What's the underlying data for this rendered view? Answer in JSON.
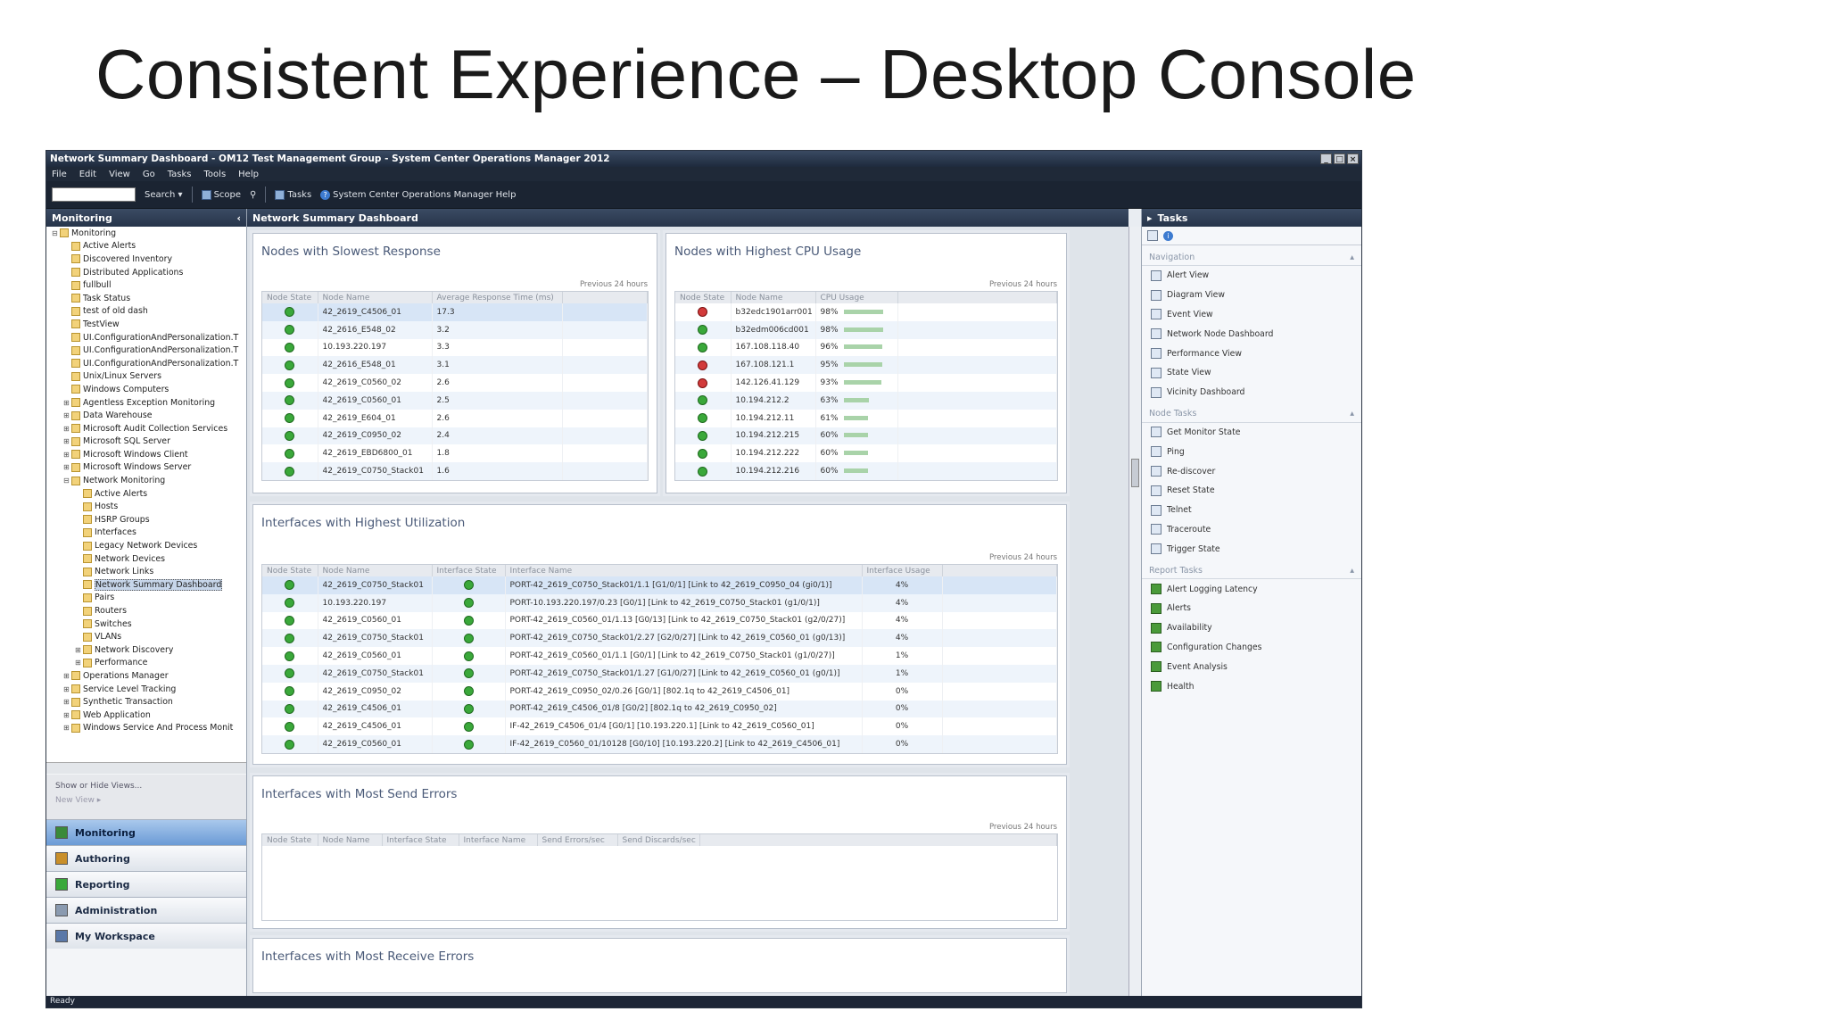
{
  "slide": {
    "title": "Consistent Experience – Desktop Console"
  },
  "window": {
    "title": "Network Summary Dashboard - OM12 Test Management Group - System Center Operations Manager 2012",
    "controls": [
      "_",
      "□",
      "×"
    ]
  },
  "menu": [
    "File",
    "Edit",
    "View",
    "Go",
    "Tasks",
    "Tools",
    "Help"
  ],
  "toolbar": {
    "search_placeholder": "",
    "search_label": "Search ▾",
    "scope": "Scope",
    "tasks": "Tasks",
    "help": "System Center Operations Manager Help"
  },
  "nav": {
    "header": "Monitoring",
    "collapse": "‹",
    "tree": [
      {
        "label": "Monitoring",
        "level": 0,
        "exp": "⊟"
      },
      {
        "label": "Active Alerts",
        "level": 1
      },
      {
        "label": "Discovered Inventory",
        "level": 1
      },
      {
        "label": "Distributed Applications",
        "level": 1
      },
      {
        "label": "fullbull",
        "level": 1
      },
      {
        "label": "Task Status",
        "level": 1
      },
      {
        "label": "test of old dash",
        "level": 1
      },
      {
        "label": "TestView",
        "level": 1
      },
      {
        "label": "UI.ConfigurationAndPersonalization.T",
        "level": 1
      },
      {
        "label": "UI.ConfigurationAndPersonalization.T",
        "level": 1
      },
      {
        "label": "UI.ConfigurationAndPersonalization.T",
        "level": 1
      },
      {
        "label": "Unix/Linux Servers",
        "level": 1
      },
      {
        "label": "Windows Computers",
        "level": 1
      },
      {
        "label": "Agentless Exception Monitoring",
        "level": 1,
        "exp": "⊞"
      },
      {
        "label": "Data Warehouse",
        "level": 1,
        "exp": "⊞"
      },
      {
        "label": "Microsoft Audit Collection Services",
        "level": 1,
        "exp": "⊞"
      },
      {
        "label": "Microsoft SQL Server",
        "level": 1,
        "exp": "⊞"
      },
      {
        "label": "Microsoft Windows Client",
        "level": 1,
        "exp": "⊞"
      },
      {
        "label": "Microsoft Windows Server",
        "level": 1,
        "exp": "⊞"
      },
      {
        "label": "Network Monitoring",
        "level": 1,
        "exp": "⊟"
      },
      {
        "label": "Active Alerts",
        "level": 2
      },
      {
        "label": "Hosts",
        "level": 2
      },
      {
        "label": "HSRP Groups",
        "level": 2
      },
      {
        "label": "Interfaces",
        "level": 2
      },
      {
        "label": "Legacy Network Devices",
        "level": 2
      },
      {
        "label": "Network Devices",
        "level": 2
      },
      {
        "label": "Network Links",
        "level": 2
      },
      {
        "label": "Network Summary Dashboard",
        "level": 2,
        "selected": true
      },
      {
        "label": "Pairs",
        "level": 2
      },
      {
        "label": "Routers",
        "level": 2
      },
      {
        "label": "Switches",
        "level": 2
      },
      {
        "label": "VLANs",
        "level": 2
      },
      {
        "label": "Network Discovery",
        "level": 2,
        "exp": "⊞"
      },
      {
        "label": "Performance",
        "level": 2,
        "exp": "⊞"
      },
      {
        "label": "Operations Manager",
        "level": 1,
        "exp": "⊞"
      },
      {
        "label": "Service Level Tracking",
        "level": 1,
        "exp": "⊞"
      },
      {
        "label": "Synthetic Transaction",
        "level": 1,
        "exp": "⊞"
      },
      {
        "label": "Web Application",
        "level": 1,
        "exp": "⊞"
      },
      {
        "label": "Windows Service And Process Monit",
        "level": 1,
        "exp": "⊞"
      }
    ],
    "show_hide": "Show or Hide Views...",
    "more": "New View ▸",
    "wunderbar": [
      {
        "label": "Monitoring",
        "active": true,
        "color": "#3a8a3a"
      },
      {
        "label": "Authoring",
        "active": false,
        "color": "#c98f2a"
      },
      {
        "label": "Reporting",
        "active": false,
        "color": "#3aa83a"
      },
      {
        "label": "Administration",
        "active": false,
        "color": "#8a9ab0"
      },
      {
        "label": "My Workspace",
        "active": false,
        "color": "#5a78a8"
      }
    ]
  },
  "main": {
    "header": "Network Summary Dashboard",
    "slowest": {
      "title": "Nodes with Slowest Response",
      "period": "Previous 24 hours",
      "columns": [
        "Node State",
        "Node Name",
        "Average Response Time (ms)"
      ],
      "rows": [
        {
          "state": "ok",
          "name": "42_2619_C4506_01",
          "value": "17.3"
        },
        {
          "state": "ok",
          "name": "42_2616_E548_02",
          "value": "3.2"
        },
        {
          "state": "ok",
          "name": "10.193.220.197",
          "value": "3.3"
        },
        {
          "state": "ok",
          "name": "42_2616_E548_01",
          "value": "3.1"
        },
        {
          "state": "ok",
          "name": "42_2619_C0560_02",
          "value": "2.6"
        },
        {
          "state": "ok",
          "name": "42_2619_C0560_01",
          "value": "2.5"
        },
        {
          "state": "ok",
          "name": "42_2619_E604_01",
          "value": "2.6"
        },
        {
          "state": "ok",
          "name": "42_2619_C0950_02",
          "value": "2.4"
        },
        {
          "state": "ok",
          "name": "42_2619_EBD6800_01",
          "value": "1.8"
        },
        {
          "state": "ok",
          "name": "42_2619_C0750_Stack01",
          "value": "1.6"
        }
      ]
    },
    "cpu": {
      "title": "Nodes with Highest CPU Usage",
      "period": "Previous 24 hours",
      "columns": [
        "Node State",
        "Node Name",
        "CPU Usage"
      ],
      "rows": [
        {
          "state": "crit",
          "name": "b32edc1901arr001",
          "value": "98%",
          "pct": 98
        },
        {
          "state": "ok",
          "name": "b32edm006cd001",
          "value": "98%",
          "pct": 98
        },
        {
          "state": "ok",
          "name": "167.108.118.40",
          "value": "96%",
          "pct": 96
        },
        {
          "state": "crit",
          "name": "167.108.121.1",
          "value": "95%",
          "pct": 95
        },
        {
          "state": "crit",
          "name": "142.126.41.129",
          "value": "93%",
          "pct": 93
        },
        {
          "state": "ok",
          "name": "10.194.212.2",
          "value": "63%",
          "pct": 63
        },
        {
          "state": "ok",
          "name": "10.194.212.11",
          "value": "61%",
          "pct": 61
        },
        {
          "state": "ok",
          "name": "10.194.212.215",
          "value": "60%",
          "pct": 60
        },
        {
          "state": "ok",
          "name": "10.194.212.222",
          "value": "60%",
          "pct": 60
        },
        {
          "state": "ok",
          "name": "10.194.212.216",
          "value": "60%",
          "pct": 60
        }
      ]
    },
    "utilization": {
      "title": "Interfaces with Highest Utilization",
      "period": "Previous 24 hours",
      "columns": [
        "Node State",
        "Node Name",
        "Interface State",
        "Interface Name",
        "Interface Usage"
      ],
      "rows": [
        {
          "name": "42_2619_C0750_Stack01",
          "iface": "PORT-42_2619_C0750_Stack01/1.1 [G1/0/1] [Link to 42_2619_C0950_04 (gi0/1)]",
          "usage": "4%"
        },
        {
          "name": "10.193.220.197",
          "iface": "PORT-10.193.220.197/0.23 [G0/1] [Link to 42_2619_C0750_Stack01 (g1/0/1)]",
          "usage": "4%"
        },
        {
          "name": "42_2619_C0560_01",
          "iface": "PORT-42_2619_C0560_01/1.13 [G0/13] [Link to 42_2619_C0750_Stack01 (g2/0/27)]",
          "usage": "4%"
        },
        {
          "name": "42_2619_C0750_Stack01",
          "iface": "PORT-42_2619_C0750_Stack01/2.27 [G2/0/27] [Link to 42_2619_C0560_01 (g0/13)]",
          "usage": "4%"
        },
        {
          "name": "42_2619_C0560_01",
          "iface": "PORT-42_2619_C0560_01/1.1 [G0/1] [Link to 42_2619_C0750_Stack01 (g1/0/27)]",
          "usage": "1%"
        },
        {
          "name": "42_2619_C0750_Stack01",
          "iface": "PORT-42_2619_C0750_Stack01/1.27 [G1/0/27] [Link to 42_2619_C0560_01 (g0/1)]",
          "usage": "1%"
        },
        {
          "name": "42_2619_C0950_02",
          "iface": "PORT-42_2619_C0950_02/0.26 [G0/1] [802.1q to 42_2619_C4506_01]",
          "usage": "0%"
        },
        {
          "name": "42_2619_C4506_01",
          "iface": "PORT-42_2619_C4506_01/8 [G0/2] [802.1q to 42_2619_C0950_02]",
          "usage": "0%"
        },
        {
          "name": "42_2619_C4506_01",
          "iface": "IF-42_2619_C4506_01/4 [G0/1] [10.193.220.1] [Link to 42_2619_C0560_01]",
          "usage": "0%"
        },
        {
          "name": "42_2619_C0560_01",
          "iface": "IF-42_2619_C0560_01/10128 [G0/10] [10.193.220.2] [Link to 42_2619_C4506_01]",
          "usage": "0%"
        }
      ]
    },
    "send_errors": {
      "title": "Interfaces with Most Send Errors",
      "period": "Previous 24 hours",
      "columns": [
        "Node State",
        "Node Name",
        "Interface State",
        "Interface Name",
        "Send Errors/sec",
        "Send Discards/sec"
      ]
    },
    "receive_errors": {
      "title": "Interfaces with Most Receive Errors"
    }
  },
  "tasks": {
    "header": "Tasks",
    "sections": [
      {
        "title": "Navigation",
        "items": [
          "Alert View",
          "Diagram View",
          "Event View",
          "Network Node Dashboard",
          "Performance View",
          "State View",
          "Vicinity Dashboard"
        ],
        "report": false
      },
      {
        "title": "Node Tasks",
        "items": [
          "Get Monitor State",
          "Ping",
          "Re-discover",
          "Reset State",
          "Telnet",
          "Traceroute",
          "Trigger State"
        ],
        "report": false
      },
      {
        "title": "Report Tasks",
        "items": [
          "Alert Logging Latency",
          "Alerts",
          "Availability",
          "Configuration Changes",
          "Event Analysis",
          "Health"
        ],
        "report": true
      }
    ]
  },
  "status": {
    "text": "Ready"
  },
  "colors": {
    "titlebar": "#26344a",
    "ok": "#3aa83a",
    "critical": "#d23a3a",
    "selection": "#d7e5f6"
  }
}
